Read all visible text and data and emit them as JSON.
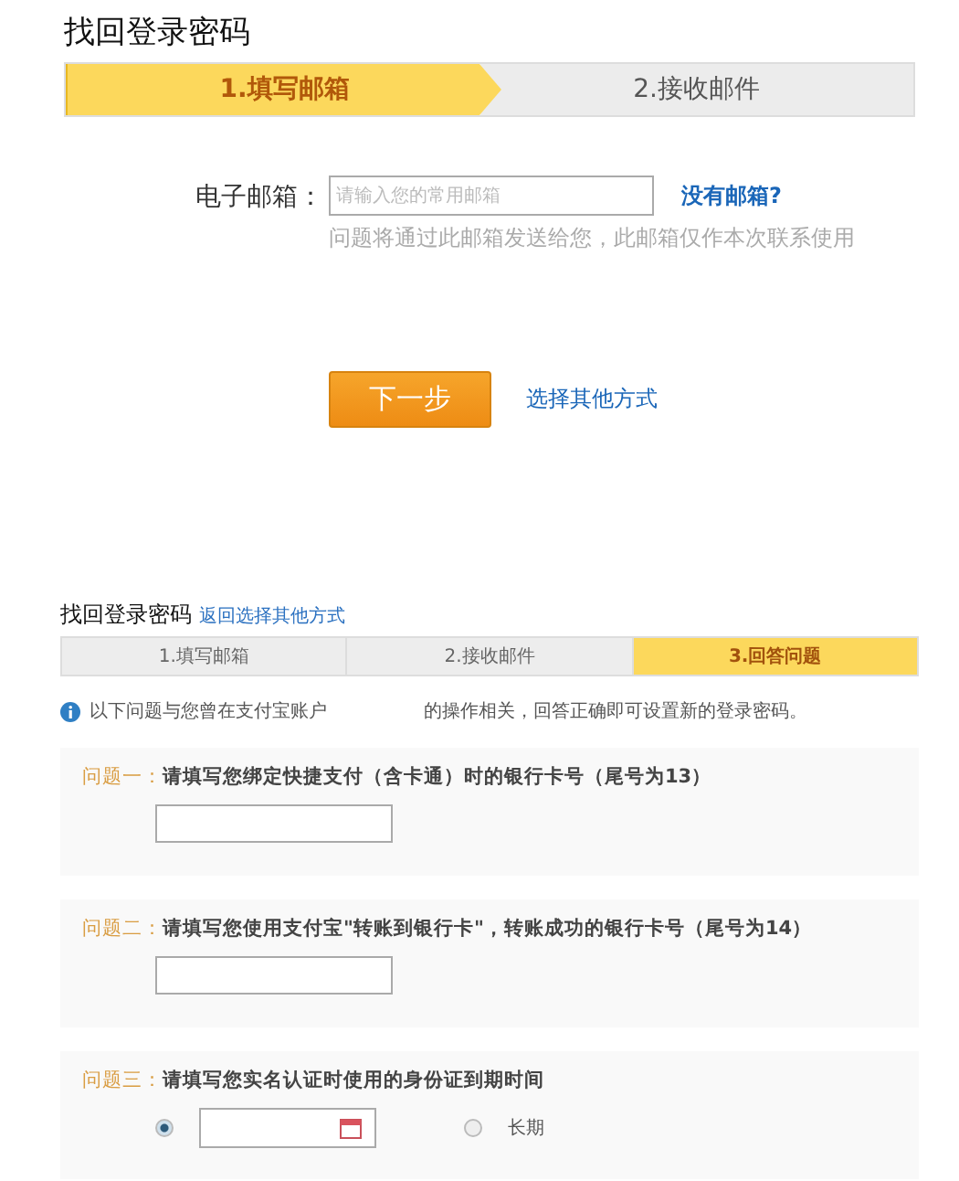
{
  "panel_1": {
    "title": "找回登录密码",
    "steps": [
      {
        "label": "1.填写邮箱",
        "selected": true
      },
      {
        "label": "2.接收邮件",
        "selected": false
      }
    ],
    "email": {
      "label": "电子邮箱：",
      "placeholder": "请输入您的常用邮箱",
      "link": "没有邮箱?",
      "hint": "问题将通过此邮箱发送给您，此邮箱仅作本次联系使用"
    },
    "next_button": "下一步",
    "other_link": "选择其他方式"
  },
  "panel_2": {
    "title": "找回登录密码",
    "back_link": "返回选择其他方式",
    "steps": [
      {
        "label": "1.填写邮箱",
        "selected": false
      },
      {
        "label": "2.接收邮件",
        "selected": false
      },
      {
        "label": "3.回答问题",
        "selected": true
      }
    ],
    "info": [
      "以下问题与您曾在支付宝账户",
      "的操作相关，回答正确即可设置新的登录密码。"
    ],
    "questions": [
      {
        "kind": "text",
        "number": "问题一：",
        "text": "请填写您绑定快捷支付（含卡通）时的银行卡号（尾号为13）"
      },
      {
        "kind": "text",
        "number": "问题二：",
        "text": "请填写您使用支付宝\"转账到银行卡\"，转账成功的银行卡号（尾号为14）"
      },
      {
        "kind": "date",
        "number": "问题三：",
        "text": "请填写您实名认证时使用的身份证到期时间",
        "options": [
          {
            "selected": true
          },
          {
            "label": "长期",
            "selected": false
          }
        ]
      }
    ]
  }
}
